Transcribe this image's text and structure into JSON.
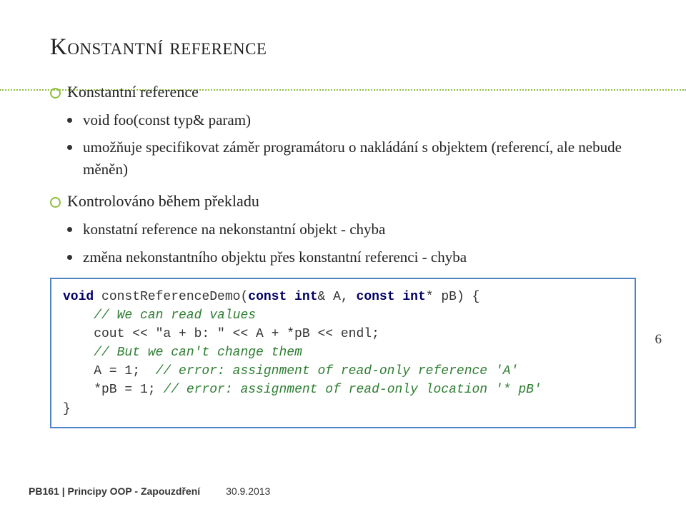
{
  "title": "Konstantní reference",
  "bullets": {
    "b1": "Konstantní reference",
    "b1_1": "void foo(const typ& param)",
    "b1_2": "umožňuje specifikovat záměr programátoru o nakládání s objektem (referencí, ale nebude měněn)",
    "b2": "Kontrolováno během překladu",
    "b2_1": "konstatní reference na nekonstantní objekt - chyba",
    "b2_2": "změna nekonstantního objektu přes konstantní referenci - chyba"
  },
  "code": {
    "line1a": "void",
    "line1b": " constReferenceDemo(",
    "line1c": "const",
    "line1d": " ",
    "line1e": "int",
    "line1f": "& A, ",
    "line1g": "const",
    "line1h": " ",
    "line1i": "int",
    "line1j": "* pB) {",
    "line2": "    // We can read values",
    "line3": "    cout << \"a + b: \" << A + *pB << endl;",
    "line4": "    // But we can't change them",
    "line5a": "    A = 1;  ",
    "line5b": "// error: assignment of read-only reference 'A'",
    "line6a": "    *pB = 1; ",
    "line6b": "// error: assignment of read-only location '* pB'",
    "line7": "}"
  },
  "footer": {
    "course": "PB161 | Principy OOP - Zapouzdření",
    "date": "30.9.2013"
  },
  "page_number": "6"
}
